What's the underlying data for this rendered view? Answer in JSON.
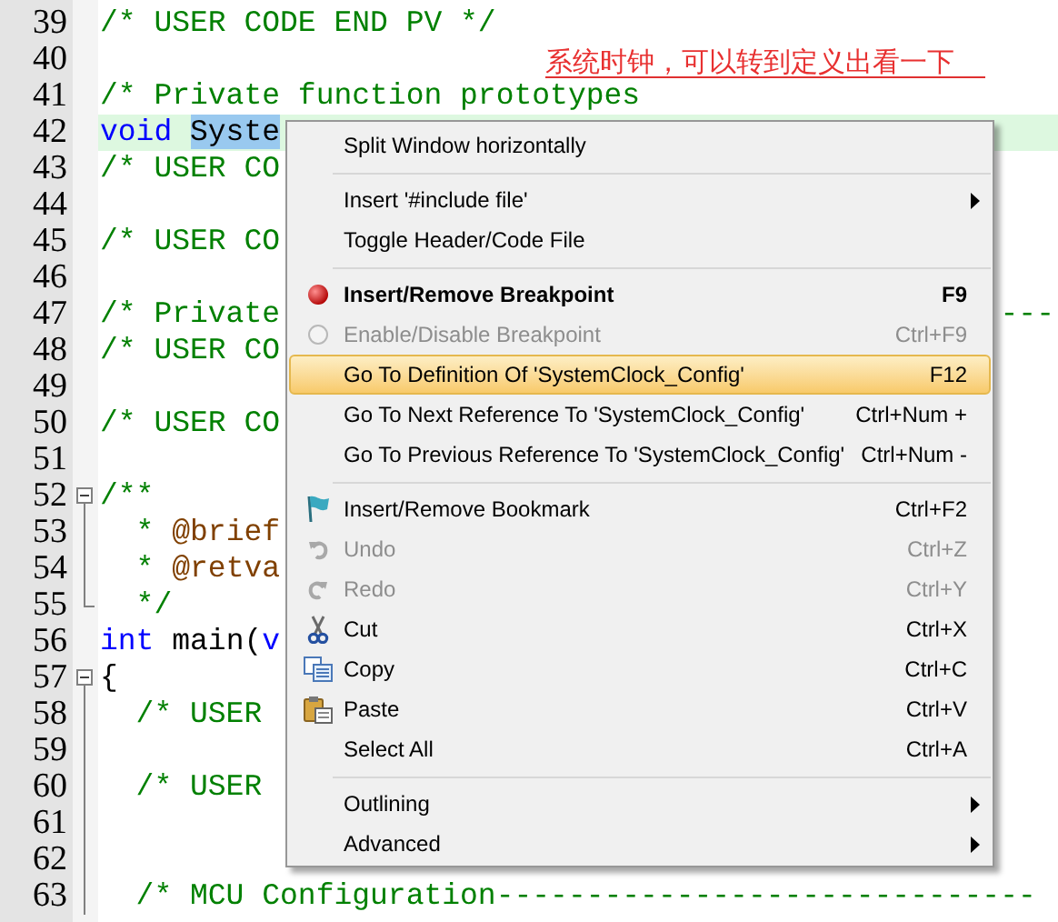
{
  "code_lines": [
    {
      "number": "39",
      "kind": "plain",
      "highlighted": false,
      "segments": [
        {
          "kind": "comment",
          "text": "/* USER CODE END PV */"
        }
      ]
    },
    {
      "number": "40",
      "kind": "plain",
      "highlighted": false
    },
    {
      "number": "41",
      "kind": "plain",
      "highlighted": false,
      "segments": [
        {
          "kind": "comment",
          "text": "/* Private function prototypes"
        }
      ]
    },
    {
      "number": "42",
      "kind": "plain",
      "highlighted": true,
      "segments": [
        {
          "kind": "keyword",
          "text": "void"
        },
        {
          "kind": "selected",
          "text": "Syste"
        }
      ]
    },
    {
      "number": "43",
      "kind": "plain",
      "highlighted": false,
      "segments": [
        {
          "kind": "comment",
          "text": "/* USER CO"
        }
      ]
    },
    {
      "number": "44",
      "kind": "plain",
      "highlighted": false
    },
    {
      "number": "45",
      "kind": "plain",
      "highlighted": false,
      "segments": [
        {
          "kind": "comment",
          "text": "/* USER CO"
        }
      ]
    },
    {
      "number": "46",
      "kind": "plain",
      "highlighted": false
    },
    {
      "number": "47",
      "kind": "plain",
      "highlighted": false,
      "segments": [
        {
          "kind": "comment",
          "text": "/* Private"
        }
      ],
      "tail": "---"
    },
    {
      "number": "48",
      "kind": "plain",
      "highlighted": false,
      "segments": [
        {
          "kind": "comment",
          "text": "/* USER CO"
        }
      ]
    },
    {
      "number": "49",
      "kind": "plain",
      "highlighted": false
    },
    {
      "number": "50",
      "kind": "plain",
      "highlighted": false,
      "segments": [
        {
          "kind": "comment",
          "text": "/* USER CO"
        }
      ]
    },
    {
      "number": "51",
      "kind": "plain",
      "highlighted": false
    },
    {
      "number": "52",
      "kind": "open",
      "highlighted": false,
      "segments": [
        {
          "kind": "comment",
          "text": "/**"
        }
      ]
    },
    {
      "number": "53",
      "kind": "inner",
      "highlighted": false,
      "segments": [
        {
          "kind": "comment",
          "text": "  * "
        },
        {
          "kind": "tag",
          "text": "@brief"
        }
      ]
    },
    {
      "number": "54",
      "kind": "inner",
      "highlighted": false,
      "segments": [
        {
          "kind": "comment",
          "text": "  * "
        },
        {
          "kind": "tag",
          "text": "@retva"
        }
      ]
    },
    {
      "number": "55",
      "kind": "close",
      "highlighted": false,
      "segments": [
        {
          "kind": "comment",
          "text": "  */"
        }
      ]
    },
    {
      "number": "56",
      "kind": "plain",
      "highlighted": false,
      "segments": [
        {
          "kind": "keyword",
          "text": "int"
        },
        {
          "kind": "plain",
          "text": " main("
        },
        {
          "kind": "keyword",
          "text": "v"
        }
      ]
    },
    {
      "number": "57",
      "kind": "open",
      "highlighted": false,
      "segments": [
        {
          "kind": "plain",
          "text": "{"
        }
      ]
    },
    {
      "number": "58",
      "kind": "inner",
      "highlighted": false,
      "segments": [
        {
          "kind": "comment",
          "text": "  /* USER"
        }
      ]
    },
    {
      "number": "59",
      "kind": "inner",
      "highlighted": false
    },
    {
      "number": "60",
      "kind": "inner",
      "highlighted": false,
      "segments": [
        {
          "kind": "comment",
          "text": "  /* USER"
        }
      ]
    },
    {
      "number": "61",
      "kind": "inner",
      "highlighted": false
    },
    {
      "number": "62",
      "kind": "inner",
      "highlighted": false
    },
    {
      "number": "63",
      "kind": "inner",
      "highlighted": false,
      "segments": [
        {
          "kind": "comment",
          "text": "  /* MCU Configuration------------------------------"
        }
      ]
    }
  ],
  "annotation": "系统时钟，可以转到定义出看一下",
  "context_menu": [
    {
      "kind": "plain",
      "label": "Split Window horizontally",
      "disabled": false,
      "selected": false,
      "bold": false,
      "submenu": false
    },
    {
      "kind": "separator"
    },
    {
      "kind": "plain",
      "label": "Insert '#include file'",
      "disabled": false,
      "selected": false,
      "bold": false,
      "submenu": true
    },
    {
      "kind": "plain",
      "label": "Toggle Header/Code File",
      "disabled": false,
      "selected": false,
      "bold": false,
      "submenu": false
    },
    {
      "kind": "separator"
    },
    {
      "kind": "breakpoint",
      "label": "Insert/Remove Breakpoint",
      "shortcut": "F9",
      "disabled": false,
      "selected": false,
      "bold": true,
      "submenu": false
    },
    {
      "kind": "toggle",
      "label": "Enable/Disable Breakpoint",
      "shortcut": "Ctrl+F9",
      "disabled": true,
      "selected": false,
      "bold": false,
      "submenu": false
    },
    {
      "kind": "plain",
      "label": "Go To Definition Of 'SystemClock_Config'",
      "shortcut": "F12",
      "disabled": false,
      "selected": true,
      "bold": false,
      "submenu": false
    },
    {
      "kind": "plain",
      "label": "Go To Next Reference To 'SystemClock_Config'",
      "shortcut": "Ctrl+Num +",
      "disabled": false,
      "selected": false,
      "bold": false,
      "submenu": false
    },
    {
      "kind": "plain",
      "label": "Go To Previous Reference To 'SystemClock_Config'",
      "shortcut": "Ctrl+Num -",
      "disabled": false,
      "selected": false,
      "bold": false,
      "submenu": false
    },
    {
      "kind": "separator"
    },
    {
      "kind": "bookmark",
      "label": "Insert/Remove Bookmark",
      "shortcut": "Ctrl+F2",
      "disabled": false,
      "selected": false,
      "bold": false,
      "submenu": false
    },
    {
      "kind": "undo",
      "label": "Undo",
      "shortcut": "Ctrl+Z",
      "disabled": true,
      "selected": false,
      "bold": false,
      "submenu": false
    },
    {
      "kind": "redo",
      "label": "Redo",
      "shortcut": "Ctrl+Y",
      "disabled": true,
      "selected": false,
      "bold": false,
      "submenu": false
    },
    {
      "kind": "cut",
      "label": "Cut",
      "shortcut": "Ctrl+X",
      "disabled": false,
      "selected": false,
      "bold": false,
      "submenu": false
    },
    {
      "kind": "copy",
      "label": "Copy",
      "shortcut": "Ctrl+C",
      "disabled": false,
      "selected": false,
      "bold": false,
      "submenu": false
    },
    {
      "kind": "paste",
      "label": "Paste",
      "shortcut": "Ctrl+V",
      "disabled": false,
      "selected": false,
      "bold": false,
      "submenu": false
    },
    {
      "kind": "plain",
      "label": "Select All",
      "shortcut": "Ctrl+A",
      "disabled": false,
      "selected": false,
      "bold": false,
      "submenu": false
    },
    {
      "kind": "separator"
    },
    {
      "kind": "plain",
      "label": "Outlining",
      "disabled": false,
      "selected": false,
      "bold": false,
      "submenu": true
    },
    {
      "kind": "plain",
      "label": "Advanced",
      "disabled": false,
      "selected": false,
      "bold": false,
      "submenu": true
    }
  ]
}
